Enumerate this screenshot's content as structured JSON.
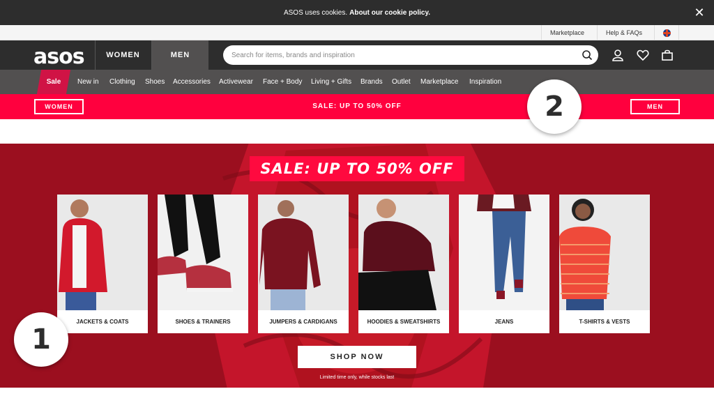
{
  "cookie_bar": {
    "text": "ASOS uses cookies.",
    "link": "About our cookie policy.",
    "close_symbol": "✕"
  },
  "utility_bar": {
    "marketplace": "Marketplace",
    "help": "Help & FAQs",
    "flag_icon": "uk-flag-icon"
  },
  "header": {
    "logo": "asos",
    "women_tab": "WOMEN",
    "men_tab": "MEN",
    "active_tab": "MEN",
    "search_placeholder": "Search for items, brands and inspiration",
    "icons": [
      "search-icon",
      "account-icon",
      "heart-icon",
      "bag-icon"
    ]
  },
  "categories": {
    "sale": "Sale",
    "items": [
      "New in",
      "Clothing",
      "Shoes",
      "Accessories",
      "Activewear",
      "Face + Body",
      "Living + Gifts",
      "Brands",
      "Outlet",
      "Marketplace",
      "Inspiration"
    ]
  },
  "sale_banner": {
    "women_button": "WOMEN",
    "text": "SALE: UP TO 50% OFF",
    "men_button": "MEN"
  },
  "hero": {
    "title": "SALE: UP TO 50% OFF",
    "cards": [
      {
        "label": "JACKETS & COATS"
      },
      {
        "label": "SHOES & TRAINERS"
      },
      {
        "label": "JUMPERS & CARDIGANS"
      },
      {
        "label": "HOODIES & SWEATSHIRTS"
      },
      {
        "label": "JEANS"
      },
      {
        "label": "T-SHIRTS & VESTS"
      }
    ],
    "shop_button": "SHOP NOW",
    "note": "Limited time only, while stocks last"
  },
  "badges": {
    "one": "1",
    "two": "2"
  },
  "colors": {
    "dark": "#2d2d2d",
    "grey": "#525050",
    "sale_red": "#ff003e",
    "hero_red": "#9b0f1f"
  }
}
